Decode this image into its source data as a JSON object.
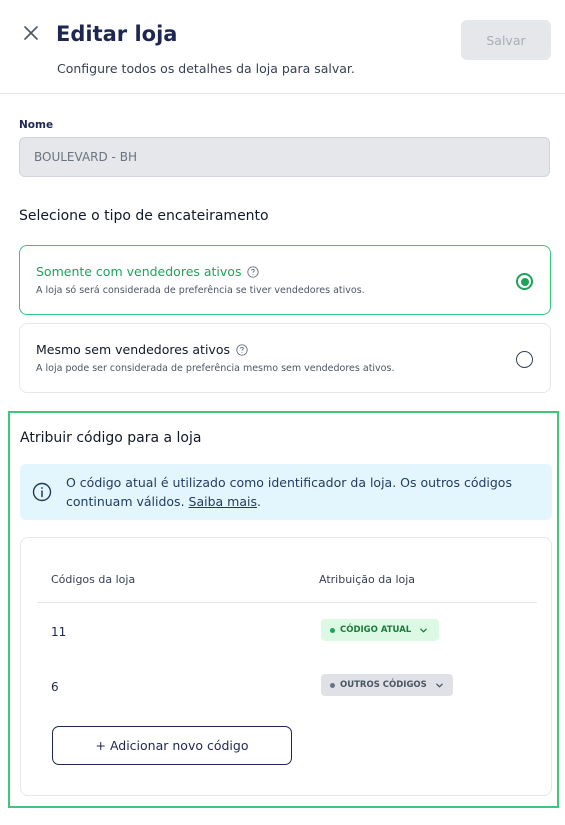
{
  "header": {
    "title": "Editar loja",
    "subtitle": "Configure todos os detalhes da loja para salvar.",
    "save_label": "Salvar",
    "close_icon": "close-icon"
  },
  "name_field": {
    "label": "Nome",
    "value": "BOULEVARD - BH"
  },
  "grouping": {
    "title": "Selecione o tipo de encateiramento",
    "options": [
      {
        "label": "Somente com vendedores ativos",
        "description": "A loja só será considerada de preferência se tiver vendedores ativos.",
        "selected": true
      },
      {
        "label": "Mesmo sem vendedores ativos",
        "description": "A loja pode ser considerada de preferência mesmo sem vendedores ativos.",
        "selected": false
      }
    ]
  },
  "codes": {
    "title": "Atribuir código para a loja",
    "info_text": "O código atual é utilizado como identificador da loja. Os outros códigos continuam válidos.",
    "info_link": "Saiba mais",
    "info_link_suffix": ".",
    "columns": [
      "Códigos da loja",
      "Atribuição da loja"
    ],
    "rows": [
      {
        "code": "11",
        "assignment": "CÓDIGO ATUAL",
        "status": "current"
      },
      {
        "code": "6",
        "assignment": "OUTROS CÓDIGOS",
        "status": "other"
      }
    ],
    "add_label": "+ Adicionar novo código"
  },
  "colors": {
    "accent_green": "#1fa35a",
    "highlight_border": "#40c57d",
    "info_bg": "#e4f6fd",
    "brand_navy": "#1e2752"
  }
}
